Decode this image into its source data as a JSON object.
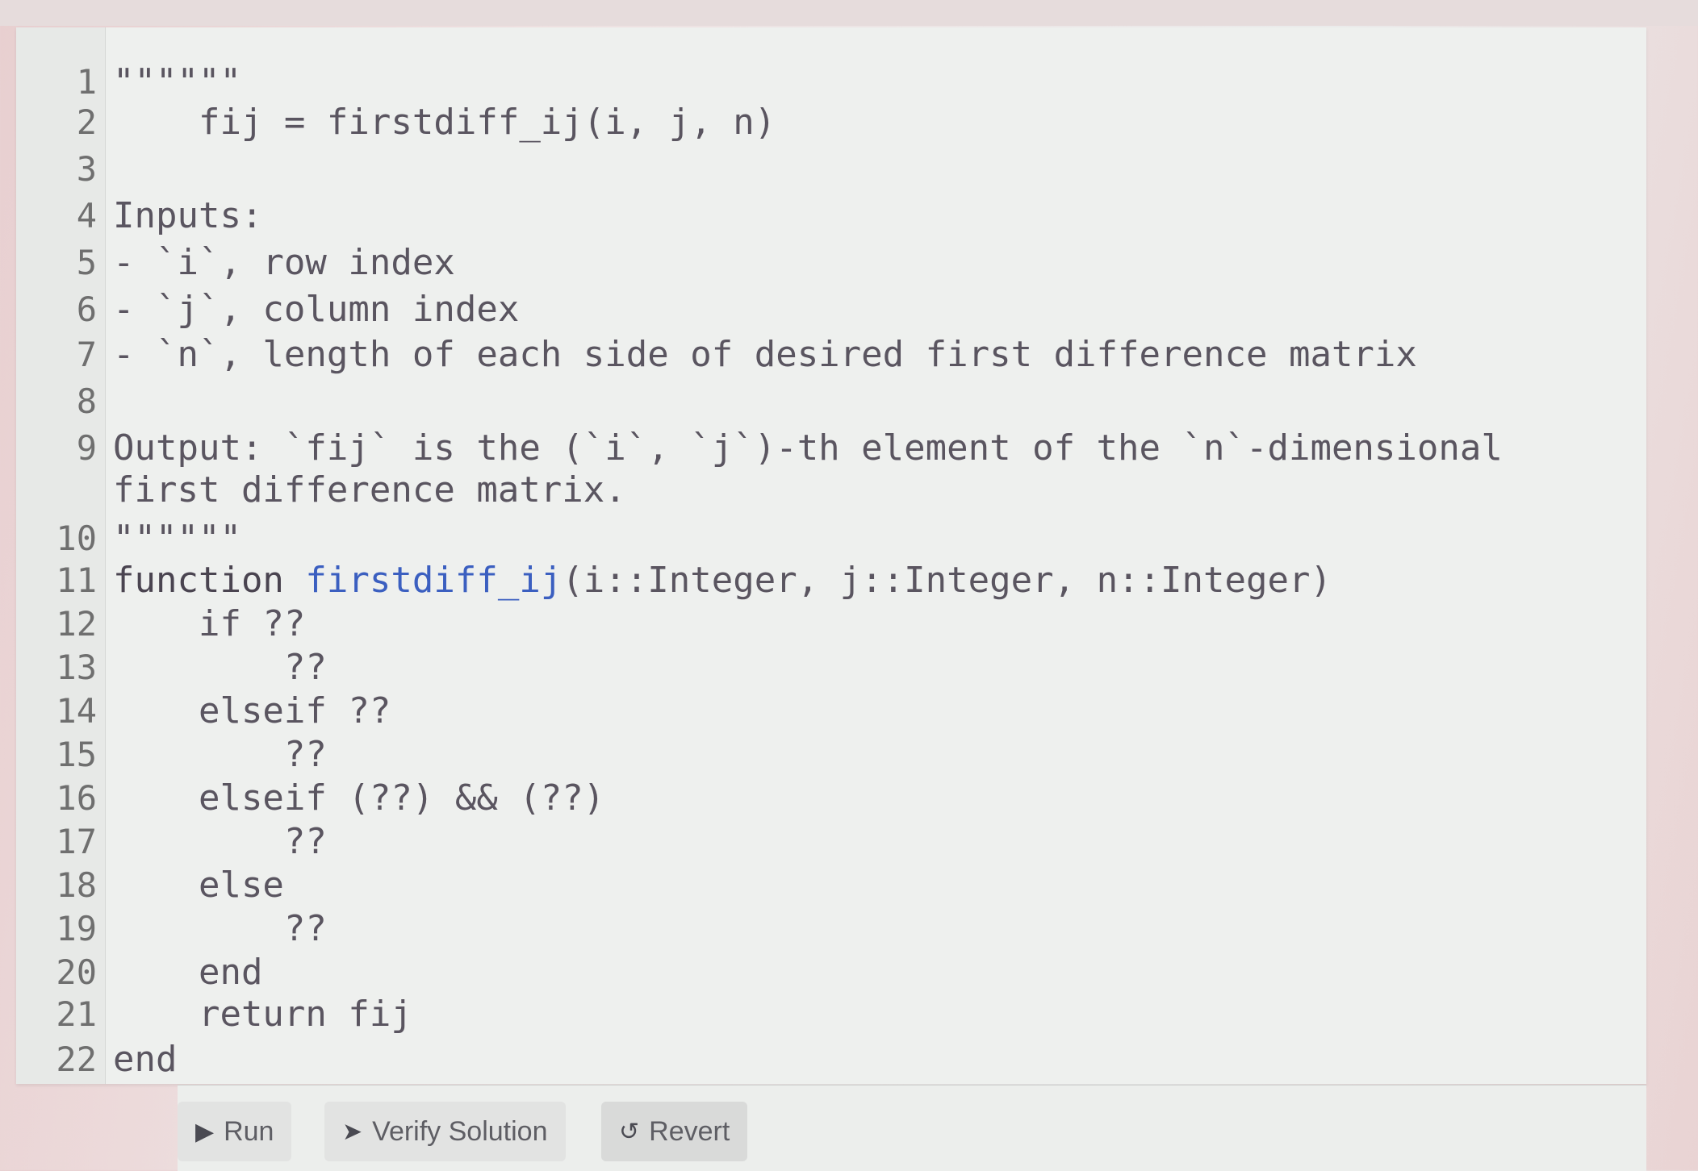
{
  "editor": {
    "lines": [
      {
        "n": "1",
        "text": "\"\"\"\"\"\""
      },
      {
        "n": "2",
        "text": "    fij = firstdiff_ij(i, j, n)"
      },
      {
        "n": "3",
        "text": ""
      },
      {
        "n": "4",
        "text": "Inputs:"
      },
      {
        "n": "5",
        "text": "- `i`, row index"
      },
      {
        "n": "6",
        "text": "- `j`, column index"
      },
      {
        "n": "7",
        "text": "- `n`, length of each side of desired first difference matrix"
      },
      {
        "n": "8",
        "text": ""
      },
      {
        "n": "9",
        "text": "Output: `fij` is the (`i`, `j`)-th element of the `n`-dimensional"
      },
      {
        "n": "",
        "text": "first difference matrix."
      },
      {
        "n": "10",
        "text": "\"\"\"\"\"\""
      },
      {
        "n": "11",
        "kw": "function ",
        "fn": "firstdiff_ij",
        "text": "(i::Integer, j::Integer, n::Integer)"
      },
      {
        "n": "12",
        "text": "    if ??"
      },
      {
        "n": "13",
        "text": "        ??"
      },
      {
        "n": "14",
        "text": "    elseif ??"
      },
      {
        "n": "15",
        "text": "        ??"
      },
      {
        "n": "16",
        "text": "    elseif (??) && (??)"
      },
      {
        "n": "17",
        "text": "        ??"
      },
      {
        "n": "18",
        "text": "    else"
      },
      {
        "n": "19",
        "text": "        ??"
      },
      {
        "n": "20",
        "text": "    end"
      },
      {
        "n": "21",
        "text": "    return fij"
      },
      {
        "n": "22",
        "text": "end"
      }
    ]
  },
  "toolbar": {
    "run": {
      "label": "Run",
      "icon": "play-icon"
    },
    "verify": {
      "label": "Verify Solution",
      "icon": "paper-plane-icon"
    },
    "revert": {
      "label": "Revert",
      "icon": "undo-icon"
    }
  },
  "colors": {
    "function_name": "#3b5fc0",
    "text": "#5a5560"
  }
}
